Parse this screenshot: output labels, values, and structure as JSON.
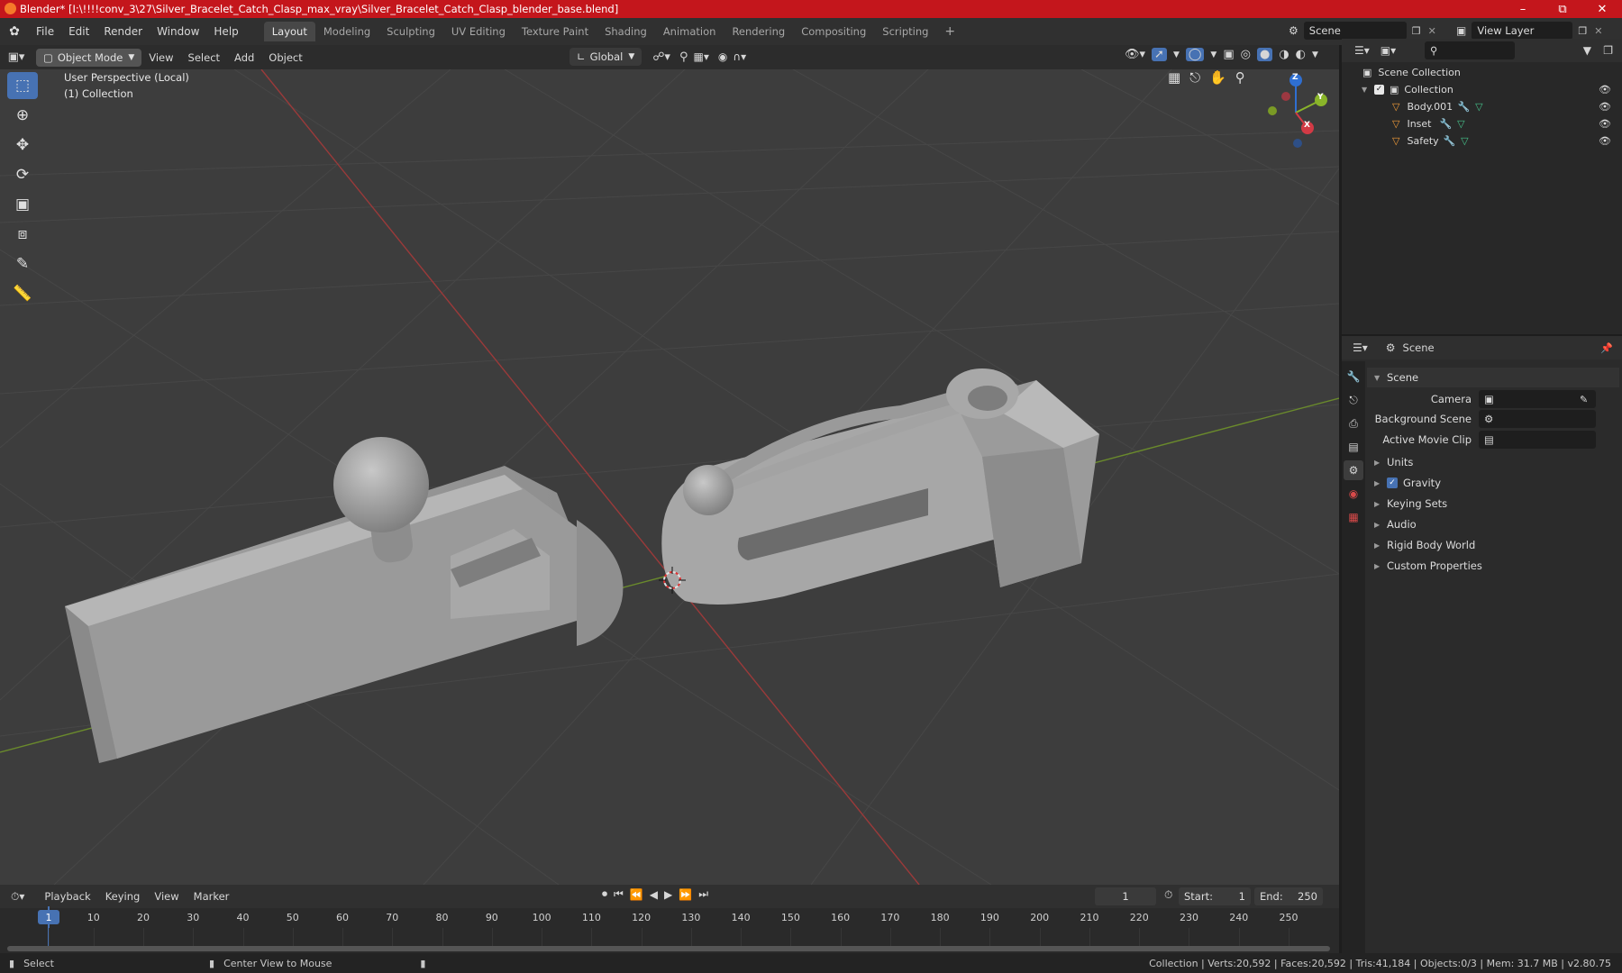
{
  "window": {
    "title": "Blender* [I:\\!!!!conv_3\\27\\Silver_Bracelet_Catch_Clasp_max_vray\\Silver_Bracelet_Catch_Clasp_blender_base.blend]",
    "controls": [
      "minimize",
      "maximize",
      "close"
    ]
  },
  "menu": [
    "File",
    "Edit",
    "Render",
    "Window",
    "Help"
  ],
  "workspaces": [
    "Layout",
    "Modeling",
    "Sculpting",
    "UV Editing",
    "Texture Paint",
    "Shading",
    "Animation",
    "Rendering",
    "Compositing",
    "Scripting"
  ],
  "active_workspace": "Layout",
  "scene_field": "Scene",
  "view_layer_field": "View Layer",
  "viewport_header": {
    "mode": "Object Mode",
    "menus": [
      "View",
      "Select",
      "Add",
      "Object"
    ],
    "transform_orientation": "Global"
  },
  "viewport": {
    "perspective_label": "User Perspective (Local)",
    "collection_label": "(1) Collection",
    "gizmo_axes": [
      "Z",
      "Y",
      "X"
    ]
  },
  "outliner": {
    "root": "Scene Collection",
    "collection": "Collection",
    "objects": [
      "Body.001",
      "Inset",
      "Safety"
    ]
  },
  "properties": {
    "header": "Scene",
    "panel": "Scene",
    "fields": [
      {
        "label": "Camera",
        "value": ""
      },
      {
        "label": "Background Scene",
        "value": ""
      },
      {
        "label": "Active Movie Clip",
        "value": ""
      }
    ],
    "sections": [
      "Units",
      "Gravity",
      "Keying Sets",
      "Audio",
      "Rigid Body World",
      "Custom Properties"
    ],
    "gravity_checked": true
  },
  "timeline": {
    "menus": [
      "Playback",
      "Keying",
      "View",
      "Marker"
    ],
    "current_frame": "1",
    "start_label": "Start:",
    "start": "1",
    "end_label": "End:",
    "end": "250",
    "ruler": [
      "1",
      "10",
      "20",
      "30",
      "40",
      "50",
      "60",
      "70",
      "80",
      "90",
      "100",
      "110",
      "120",
      "130",
      "140",
      "150",
      "160",
      "170",
      "180",
      "190",
      "200",
      "210",
      "220",
      "230",
      "240",
      "250"
    ]
  },
  "status": {
    "left_action": "Select",
    "middle_action": "Center View to Mouse",
    "stats": "Collection | Verts:20,592 | Faces:20,592 | Tris:41,184 | Objects:0/3 | Mem: 31.7 MB | v2.80.75"
  }
}
